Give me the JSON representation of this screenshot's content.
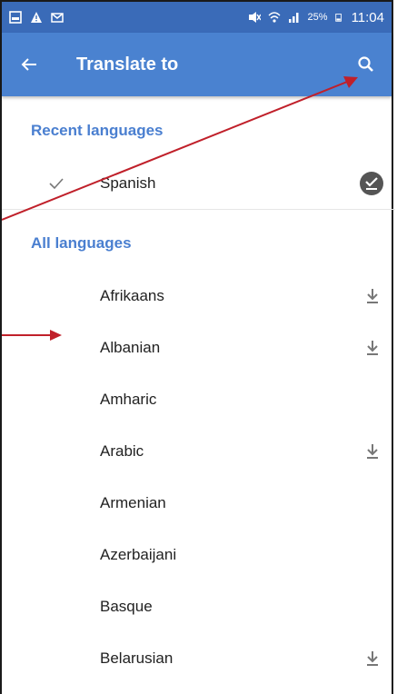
{
  "status_bar": {
    "battery": "25%",
    "time": "11:04"
  },
  "app_bar": {
    "title": "Translate to"
  },
  "recent_header": "Recent languages",
  "recent_items": [
    {
      "label": "Spanish"
    }
  ],
  "all_header": "All languages",
  "all_items": [
    {
      "label": "Afrikaans",
      "downloadable": true
    },
    {
      "label": "Albanian",
      "downloadable": true
    },
    {
      "label": "Amharic",
      "downloadable": false
    },
    {
      "label": "Arabic",
      "downloadable": true
    },
    {
      "label": "Armenian",
      "downloadable": false
    },
    {
      "label": "Azerbaijani",
      "downloadable": false
    },
    {
      "label": "Basque",
      "downloadable": false
    },
    {
      "label": "Belarusian",
      "downloadable": true
    }
  ],
  "colors": {
    "status_bar": "#3a6bb8",
    "app_bar": "#4a82d0",
    "section_header": "#4a7fd0",
    "annotation_arrow": "#c0202a"
  }
}
